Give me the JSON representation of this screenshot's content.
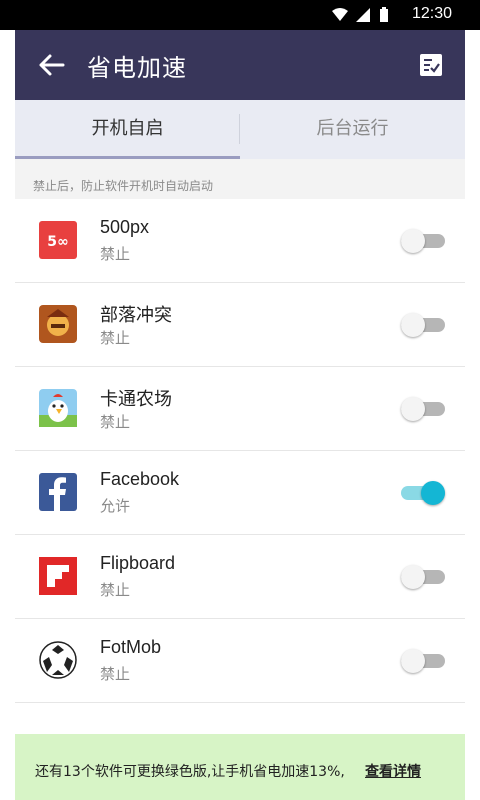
{
  "status_bar": {
    "time": "12:30"
  },
  "header": {
    "title": "省电加速"
  },
  "tabs": [
    {
      "label": "开机自启"
    },
    {
      "label": "后台运行"
    }
  ],
  "hint": "禁止后，防止软件开机时自动启动",
  "apps": [
    {
      "name": "500px",
      "status": "禁止",
      "enabled": false,
      "icon": "500px-icon"
    },
    {
      "name": "部落冲突",
      "status": "禁止",
      "enabled": false,
      "icon": "clash-of-clans-icon"
    },
    {
      "name": "卡通农场",
      "status": "禁止",
      "enabled": false,
      "icon": "hay-day-icon"
    },
    {
      "name": "Facebook",
      "status": "允许",
      "enabled": true,
      "icon": "facebook-icon"
    },
    {
      "name": "Flipboard",
      "status": "禁止",
      "enabled": false,
      "icon": "flipboard-icon"
    },
    {
      "name": "FotMob",
      "status": "禁止",
      "enabled": false,
      "icon": "fotmob-icon"
    }
  ],
  "promo": {
    "text": "还有13个软件可更换绿色版,让手机省电加速13%,",
    "link": "查看详情"
  },
  "colors": {
    "header_bg": "#38365a",
    "toggle_on": "#14b6d4",
    "promo_bg": "#d7f4c6"
  }
}
